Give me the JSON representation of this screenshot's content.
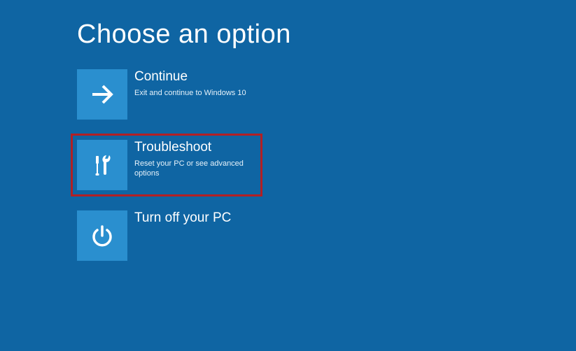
{
  "page": {
    "title": "Choose an option"
  },
  "options": {
    "continue": {
      "title": "Continue",
      "desc": "Exit and continue to Windows 10"
    },
    "troubleshoot": {
      "title": "Troubleshoot",
      "desc": "Reset your PC or see advanced options"
    },
    "turnoff": {
      "title": "Turn off your PC",
      "desc": ""
    }
  },
  "colors": {
    "background": "#0f65a3",
    "tile": "#2a8fcf",
    "highlight": "#b22024"
  }
}
